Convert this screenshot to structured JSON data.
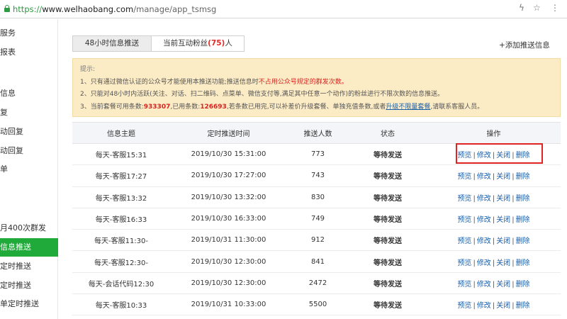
{
  "browser": {
    "url_scheme": "https://",
    "url_host": "www.welhaobang.com",
    "url_path": "/manage/app_tsmsg"
  },
  "sidebar": {
    "items": [
      {
        "label": "服务",
        "active": false
      },
      {
        "label": "报表",
        "active": false
      },
      {
        "label": "",
        "active": false
      },
      {
        "label": "信息",
        "active": false
      },
      {
        "label": "复",
        "active": false
      },
      {
        "label": "动回复",
        "active": false
      },
      {
        "label": "动回复",
        "active": false
      },
      {
        "label": "单",
        "active": false
      },
      {
        "label": "",
        "active": false
      },
      {
        "label": "",
        "active": false
      },
      {
        "label": "月400次群发",
        "active": false
      },
      {
        "label": "信息推送",
        "active": true
      },
      {
        "label": "定时推送",
        "active": false
      },
      {
        "label": "定时推送",
        "active": false
      },
      {
        "label": "单定时推送",
        "active": false
      }
    ]
  },
  "tabs": {
    "tab1": "48小时信息推送",
    "tab2_prefix": "当前互动粉丝",
    "tab2_count": "(75)",
    "tab2_suffix": "人"
  },
  "add_link": "+添加推送信息",
  "notice": {
    "title": "提示:",
    "line1_a": "1、只有通过微信认证的公众号才能使用本推送功能;推送信息时",
    "line1_red": "不占用公众号规定的群发次数。",
    "line2": "2、只能对48小时内活跃(关注、对话、扫二维码、点菜单、微信支付等,满足其中任意一个动作)的粉丝进行不限次数的信息推送。",
    "line3_a": "3、当前套餐可用条数:",
    "line3_avail": "933307",
    "line3_b": ",已用条数:",
    "line3_used": "126693",
    "line3_c": ",若条数已用完,可以补差价升级套餐、单独充值条数,或者",
    "line3_link": "升级不限量套餐",
    "line3_d": ",请联系客服人员。"
  },
  "table": {
    "headers": [
      "信息主题",
      "定时推送时间",
      "推送人数",
      "状态",
      "操作"
    ],
    "ops": [
      "预览",
      "修改",
      "关闭",
      "删除"
    ],
    "rows": [
      {
        "subject": "每天-客服15:31",
        "time": "2019/10/30 15:31:00",
        "count": "773",
        "status": "等待发送"
      },
      {
        "subject": "每天-客服17:27",
        "time": "2019/10/30 17:27:00",
        "count": "743",
        "status": "等待发送"
      },
      {
        "subject": "每天-客服13:32",
        "time": "2019/10/30 13:32:00",
        "count": "830",
        "status": "等待发送"
      },
      {
        "subject": "每天-客服16:33",
        "time": "2019/10/30 16:33:00",
        "count": "749",
        "status": "等待发送"
      },
      {
        "subject": "每天-客服11:30-",
        "time": "2019/10/31 11:30:00",
        "count": "912",
        "status": "等待发送"
      },
      {
        "subject": "每天-客服12:30-",
        "time": "2019/10/30 12:30:00",
        "count": "841",
        "status": "等待发送"
      },
      {
        "subject": "每天-会话代码12:30",
        "time": "2019/10/30 12:30:00",
        "count": "2472",
        "status": "等待发送"
      },
      {
        "subject": "每天-客服10:33",
        "time": "2019/10/31 10:33:00",
        "count": "5500",
        "status": "等待发送"
      }
    ]
  }
}
